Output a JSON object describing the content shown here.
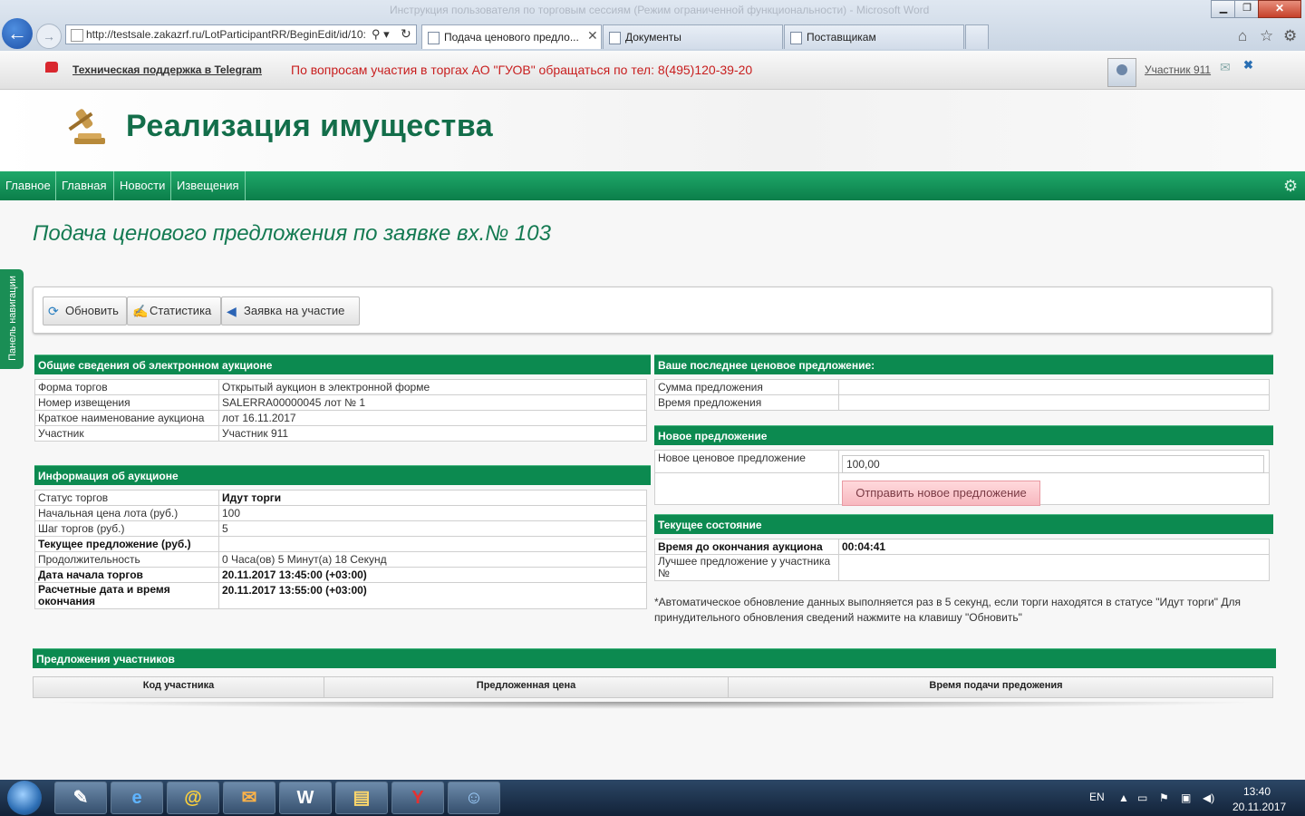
{
  "browser": {
    "window_title": "Инструкция пользователя по торговым сессиям (Режим ограниченной функциональности) - Microsoft Word",
    "address": "http://testsale.zakazrf.ru/LotParticipantRR/BeginEdit/id/10:",
    "tabs": [
      {
        "label": "Подача ценового предло..."
      },
      {
        "label": "Документы"
      },
      {
        "label": "Поставщикам"
      }
    ]
  },
  "infobar": {
    "telegram_link": "Техническая поддержка в Telegram",
    "contact_message": "По вопросам участия в торгах АО \"ГУОВ\" обращаться по тел: 8(495)120-39-20",
    "user_name": "Участник 911"
  },
  "site": {
    "title": "Реализация имущества"
  },
  "nav": {
    "items": [
      "Главное",
      "Главная",
      "Новости",
      "Извещения"
    ]
  },
  "page": {
    "heading": "Подача ценового предложения по заявке вх.№ 103",
    "side_panel": "Панель навигации"
  },
  "toolbar": {
    "refresh": "Обновить",
    "statistics": "Статистика",
    "application": "Заявка на участие"
  },
  "general": {
    "title": "Общие сведения об электронном аукционе",
    "rows": [
      {
        "label": "Форма торгов",
        "value": "Открытый аукцион в электронной форме"
      },
      {
        "label": "Номер извещения",
        "value": "SALERRA00000045 лот № 1"
      },
      {
        "label": "Краткое наименование аукциона",
        "value": "лот 16.11.2017"
      },
      {
        "label": "Участник",
        "value": "Участник 911"
      }
    ]
  },
  "auction_info": {
    "title": "Информация об аукционе",
    "rows": [
      {
        "label": "Статус торгов",
        "value": "Идут торги"
      },
      {
        "label": "Начальная цена лота (руб.)",
        "value": "100"
      },
      {
        "label": "Шаг торгов (руб.)",
        "value": "5"
      },
      {
        "label": "Текущее предложение (руб.)",
        "value": ""
      },
      {
        "label": "Продолжительность",
        "value": "0 Часа(ов) 5 Минут(а) 18 Секунд"
      },
      {
        "label": "Дата начала торгов",
        "value": "20.11.2017 13:45:00 (+03:00)"
      },
      {
        "label": "Расчетные дата и время окончания",
        "value": "20.11.2017 13:55:00 (+03:00)"
      }
    ]
  },
  "last_bid": {
    "title": "Ваше последнее ценовое предложение:",
    "rows": [
      {
        "label": "Сумма предложения",
        "value": ""
      },
      {
        "label": "Время предложения",
        "value": ""
      }
    ]
  },
  "new_bid": {
    "title": "Новое предложение",
    "label": "Новое ценовое предложение",
    "value": "100,00",
    "submit": "Отправить новое предложение"
  },
  "current_state": {
    "title": "Текущее состояние",
    "rows": [
      {
        "label": "Время до окончания аукциона",
        "value": "00:04:41"
      },
      {
        "label": "Лучшее предложение у участника №",
        "value": ""
      }
    ]
  },
  "note": "*Автоматическое обновление данных выполняется раз в 5 секунд, если торги находятся в статусе \"Идут торги\" Для принудительного обновления сведений нажмите на клавишу \"Обновить\"",
  "offers": {
    "title": "Предложения участников",
    "columns": [
      "Код участника",
      "Предложенная цена",
      "Время подачи предожения"
    ]
  },
  "taskbar": {
    "lang": "EN",
    "time": "13:40",
    "date": "20.11.2017"
  },
  "colors": {
    "brand_green": "#0c8a50",
    "title_green": "#136e4a",
    "alert_red": "#c81e1e",
    "submit_pink": "#f7b8bf"
  }
}
